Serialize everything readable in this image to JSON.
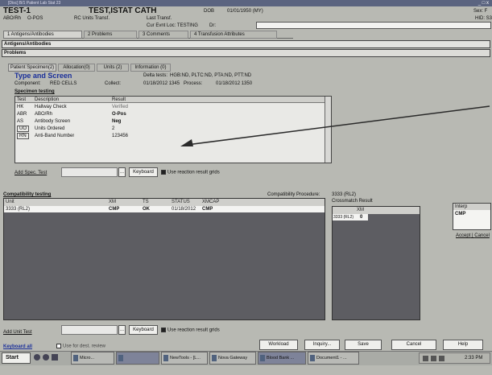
{
  "titlebar": {
    "title": "[Disc] B/1 Patient Lab Stat 23",
    "controls": "_ □ x"
  },
  "header": {
    "unit": "TEST-1",
    "patient_name": "TEST,ISTAT CATH",
    "dob_label": "DOB",
    "dob_value": "01/01/1950 (MY)",
    "sex_label": "Sex: F",
    "mrn_label": "ABO/Rh",
    "mrn_value": "O-POS",
    "rc_label": "RC Units Transf.",
    "last_transf": "Last Transf.",
    "cur_loc": "Cur Evnt Loc: TESTING",
    "dr_label": "Dr: ",
    "hid_label": "HID: S3"
  },
  "top_tabs": [
    "1 Antigens/Antibodies",
    "2 Problems",
    "3 Comments",
    "4 Transfusion Attributes"
  ],
  "section": {
    "title": "Antigens/Antibodies",
    "problems_label": "Problems"
  },
  "sub_tabs": [
    "Patient Specimen(2)",
    "Allocation(0)",
    "Units (2)",
    "Information (0)"
  ],
  "specimen": {
    "type_label": "Type and Screen",
    "delta_tests_label": "Delta tests:",
    "delta_tests_value": "HGB:ND, PLTC:ND, PTA:ND, PTT:ND",
    "component_label": "Component:",
    "component_value": "RED CELLS",
    "collect_label": "Collect:",
    "collect_value": "01/18/2012 1345",
    "process_label": "Process:",
    "process_value": "01/18/2012 1350",
    "testing_label": "Specimen testing"
  },
  "spec_table": {
    "headers": [
      "Test",
      "Description",
      "Result"
    ],
    "rows": [
      {
        "test": "HK",
        "desc": "Hallway Check",
        "result": "Verified"
      },
      {
        "test": "ABR",
        "desc": "ABO/Rh",
        "result": "O-Pos"
      },
      {
        "test": "AS",
        "desc": "Antibody Screen",
        "result": "Neg"
      },
      {
        "test": "UO",
        "desc": "Units Ordered",
        "result": "2"
      },
      {
        "test": "RN",
        "desc": "Anti-Band Number",
        "result": "123456"
      }
    ]
  },
  "add_spec": {
    "label": "Add Spec. Test",
    "keyboard": "Keyboard",
    "use_result": "Use reaction result grids"
  },
  "compat": {
    "testing_label": "Compatibility testing",
    "headers": [
      "Unit",
      "XM",
      "TS",
      "STATUS",
      "XMCAP"
    ],
    "rows": [
      {
        "unit": "3333 (RL2)",
        "xm": "CMP",
        "ts": "OK",
        "status": "01/18/2012",
        "xmcap": "CMP"
      }
    ],
    "procedure_label": "Compatibility Procedure:",
    "procedure_value": "3333 (RL2)",
    "result_label": "Crossmatch Result",
    "result_headers": [
      "",
      "XM"
    ],
    "result_rows": [
      {
        "unit": "3333 (RL2)",
        "xm": "0"
      }
    ]
  },
  "interp": {
    "header": "Interp",
    "value": "CMP",
    "accept": "Accept",
    "cancel": "Cancel"
  },
  "add_unit": {
    "label": "Add Unit Test",
    "keyboard": "Keyboard",
    "use_result": "Use reaction result grids"
  },
  "bottom": {
    "keyboard_all": "Keyboard all",
    "use_for_dest": "Use for dest. review",
    "workload": "Workload",
    "inquiry": "Inquiry...",
    "save": "Save",
    "cancel": "Cancel",
    "help": "Help"
  },
  "taskbar": {
    "start": "Start",
    "tasks": [
      "Micro...",
      "",
      "NewTools - [L...",
      "Nova Gateway",
      "Blood Bank ...",
      "Document1 - ..."
    ],
    "time": "2:33 PM"
  },
  "colors": {
    "grid": "#5d5d62",
    "window": "#b8b9b3",
    "highlight": "#1a2f9a",
    "taskbar": "#b9bab6"
  }
}
